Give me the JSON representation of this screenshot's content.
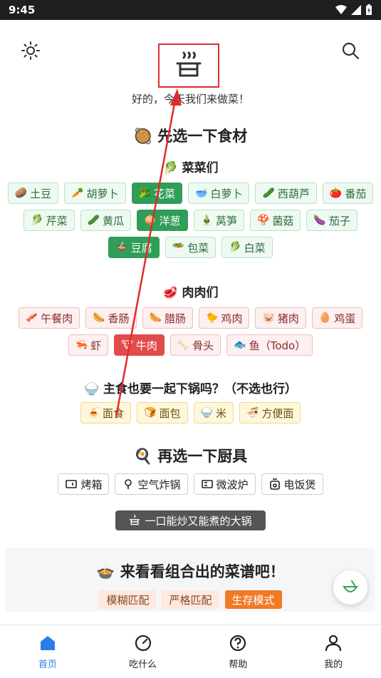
{
  "status": {
    "time": "9:45"
  },
  "header": {
    "tagline": "好的，今天我们来做菜！"
  },
  "ingredients": {
    "title": "先选一下食材",
    "vegetables_title": "菜菜们",
    "vegetables_rows": [
      [
        {
          "label": "土豆",
          "emoji": "🥔",
          "selected": false
        },
        {
          "label": "胡萝卜",
          "emoji": "🥕",
          "selected": false
        },
        {
          "label": "花菜",
          "emoji": "🥦",
          "selected": true
        },
        {
          "label": "白萝卜",
          "emoji": "🥣",
          "selected": false
        },
        {
          "label": "西葫芦",
          "emoji": "🥒",
          "selected": false
        },
        {
          "label": "番茄",
          "emoji": "🍅",
          "selected": false
        }
      ],
      [
        {
          "label": "芹菜",
          "emoji": "🥬",
          "selected": false
        },
        {
          "label": "黄瓜",
          "emoji": "🥒",
          "selected": false
        },
        {
          "label": "洋葱",
          "emoji": "🧅",
          "selected": true
        },
        {
          "label": "莴笋",
          "emoji": "🎍",
          "selected": false
        },
        {
          "label": "菌菇",
          "emoji": "🍄",
          "selected": false
        },
        {
          "label": "茄子",
          "emoji": "🍆",
          "selected": false
        }
      ],
      [
        {
          "label": "豆腐",
          "emoji": "🍲",
          "selected": true
        },
        {
          "label": "包菜",
          "emoji": "🥗",
          "selected": false
        },
        {
          "label": "白菜",
          "emoji": "🥬",
          "selected": false
        }
      ]
    ],
    "meat_title": "肉肉们",
    "meat_rows": [
      [
        {
          "label": "午餐肉",
          "emoji": "🥓",
          "selected": false
        },
        {
          "label": "香肠",
          "emoji": "🌭",
          "selected": false
        },
        {
          "label": "腊肠",
          "emoji": "🌭",
          "selected": false
        },
        {
          "label": "鸡肉",
          "emoji": "🐤",
          "selected": false
        },
        {
          "label": "猪肉",
          "emoji": "🐷",
          "selected": false
        },
        {
          "label": "鸡蛋",
          "emoji": "🥚",
          "selected": false
        }
      ],
      [
        {
          "label": "虾",
          "emoji": "🦐",
          "selected": false
        },
        {
          "label": "牛肉",
          "emoji": "🐮",
          "selected": true
        },
        {
          "label": "骨头",
          "emoji": "🦴",
          "selected": false
        },
        {
          "label": "鱼（Todo）",
          "emoji": "🐟",
          "selected": false
        }
      ]
    ]
  },
  "staples": {
    "title": "主食也要一起下锅吗？（不选也行）",
    "items": [
      {
        "label": "面食",
        "emoji": "🍝"
      },
      {
        "label": "面包",
        "emoji": "🍞"
      },
      {
        "label": "米",
        "emoji": "🍚"
      },
      {
        "label": "方便面",
        "emoji": "🍜"
      }
    ]
  },
  "tools": {
    "title": "再选一下厨具",
    "items": [
      {
        "label": "烤箱"
      },
      {
        "label": "空气炸锅"
      },
      {
        "label": "微波炉"
      },
      {
        "label": "电饭煲"
      }
    ],
    "tooltip": "一口能炒又能煮的大锅"
  },
  "recipes": {
    "title": "来看看组合出的菜谱吧！",
    "modes": [
      {
        "label": "模糊匹配",
        "active": false
      },
      {
        "label": "严格匹配",
        "active": false
      },
      {
        "label": "生存模式",
        "active": true
      }
    ]
  },
  "nav": [
    {
      "label": "首页",
      "icon": "home-icon",
      "active": true
    },
    {
      "label": "吃什么",
      "icon": "compass-icon",
      "active": false
    },
    {
      "label": "帮助",
      "icon": "help-icon",
      "active": false
    },
    {
      "label": "我的",
      "icon": "user-icon",
      "active": false
    }
  ],
  "colors": {
    "accent": "#2b7de9",
    "veg_selected": "#2f9e57",
    "meat_selected": "#e24b4b",
    "mode_active": "#f07a26"
  }
}
